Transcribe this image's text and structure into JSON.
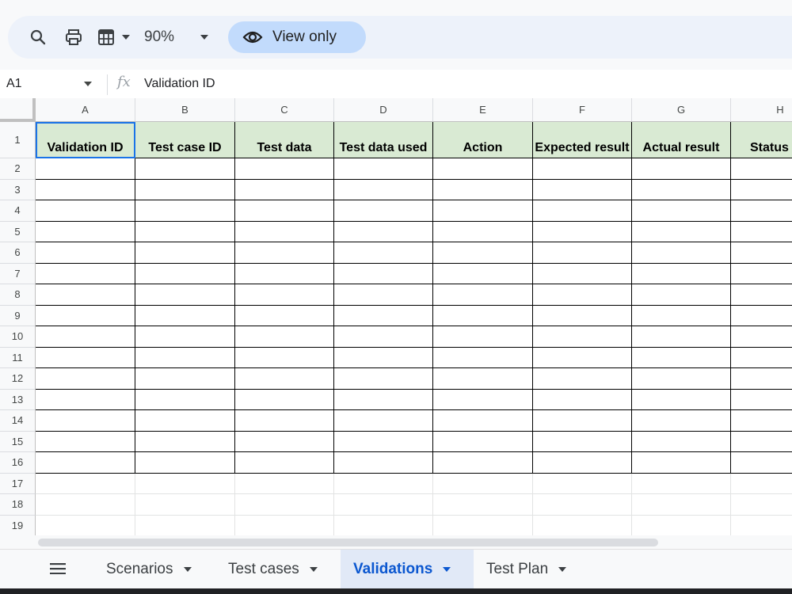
{
  "toolbar": {
    "icons": [
      "search-icon",
      "print-icon",
      "format-table-icon",
      "chevron-down-icon"
    ],
    "zoom": "90%",
    "view_mode": "View only"
  },
  "formula_bar": {
    "cell_ref": "A1",
    "fx": "fx",
    "content": "Validation ID"
  },
  "grid": {
    "columns": [
      "A",
      "B",
      "C",
      "D",
      "E",
      "F",
      "G",
      "H"
    ],
    "rows": [
      "1",
      "2",
      "3",
      "4",
      "5",
      "6",
      "7",
      "8",
      "9",
      "10",
      "11",
      "12",
      "13",
      "14",
      "15",
      "16",
      "17",
      "18",
      "19"
    ],
    "header_row": [
      "Validation ID",
      "Test case ID",
      "Test data",
      "Test data used",
      "Action",
      "Expected result",
      "Actual result",
      "Status"
    ],
    "header_fill": "#d9ead3",
    "selection_color": "#1a73e8"
  },
  "sheets": {
    "tabs": [
      {
        "label": "Scenarios",
        "active": false
      },
      {
        "label": "Test cases",
        "active": false
      },
      {
        "label": "Validations",
        "active": true
      },
      {
        "label": "Test Plan",
        "active": false
      }
    ],
    "active_color": "#0b57d0"
  }
}
